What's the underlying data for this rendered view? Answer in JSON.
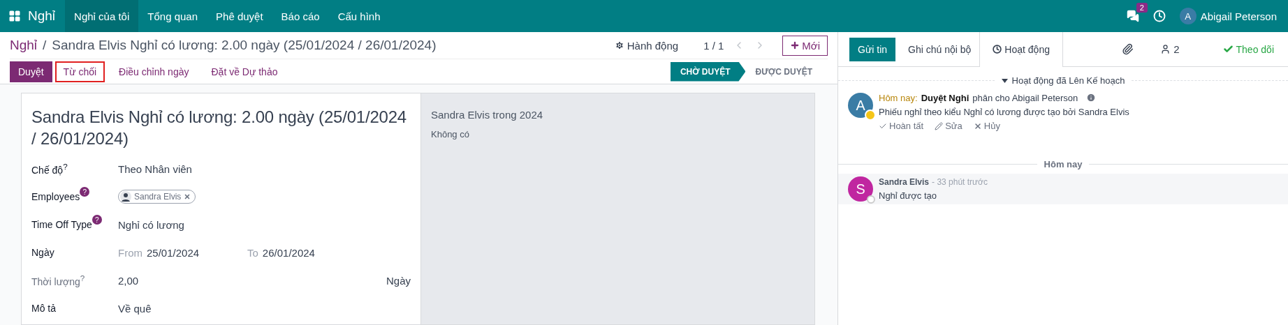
{
  "app": {
    "name": "Nghỉ",
    "menu": [
      {
        "label": "Nghỉ của tôi",
        "selected": true
      },
      {
        "label": "Tổng quan",
        "selected": false
      },
      {
        "label": "Phê duyệt",
        "selected": false
      },
      {
        "label": "Báo cáo",
        "selected": false
      },
      {
        "label": "Cấu hình",
        "selected": false
      }
    ]
  },
  "systray": {
    "messages_badge": "2",
    "user": {
      "initial": "A",
      "name": "Abigail Peterson"
    }
  },
  "breadcrumb": {
    "parent": "Nghỉ",
    "separator": "/",
    "current": "Sandra Elvis Nghỉ có lương: 2.00 ngày (25/01/2024 / 26/01/2024)"
  },
  "actions_label": "Hành động",
  "pager": "1 / 1",
  "new_button": "Mới",
  "buttons": [
    {
      "label": "Duyệt",
      "kind": "primary",
      "highlighted": false
    },
    {
      "label": "Từ chối",
      "kind": "link",
      "highlighted": true
    },
    {
      "label": "Điều chỉnh ngày",
      "kind": "link",
      "highlighted": false
    },
    {
      "label": "Đặt về Dự thảo",
      "kind": "link",
      "highlighted": false
    }
  ],
  "statusbar": [
    {
      "label": "CHỜ DUYỆT",
      "selected": true
    },
    {
      "label": "ĐƯỢC DUYỆT",
      "selected": false
    }
  ],
  "form": {
    "title": "Sandra Elvis Nghỉ có lương: 2.00 ngày (25/01/2024 / 26/01/2024)",
    "fields": [
      {
        "kind": "text",
        "label": "Chế độ$^{?}$",
        "muted": false,
        "value": "Theo Nhân viên"
      },
      {
        "kind": "tags",
        "label": "Employees",
        "help": "?",
        "muted": false,
        "tags": [
          "Sandra Elvis"
        ]
      },
      {
        "kind": "text",
        "label": "Time Off Type",
        "help": "?",
        "muted": false,
        "value": "Nghỉ có lương"
      },
      {
        "kind": "daterange",
        "label": "Ngày",
        "muted": false,
        "from_label": "From",
        "from": "25/01/2024",
        "to_label": "To",
        "to": "26/01/2024"
      },
      {
        "kind": "duration",
        "label": "Thời lượng$^{?}$",
        "muted": true,
        "value": "2,00",
        "unit": "Ngày"
      },
      {
        "kind": "text",
        "label": "Mô tả",
        "muted": false,
        "value": "Về quê"
      }
    ]
  },
  "side_panel": {
    "title": "Sandra Elvis trong 2024",
    "text": "Không có"
  },
  "chatter": {
    "tabs": [
      {
        "kind": "send",
        "label": "Gửi tin",
        "selected": true
      },
      {
        "kind": "note",
        "label": "Ghi chú nội bộ",
        "selected": false
      },
      {
        "kind": "activity",
        "label": "Hoạt động",
        "selected": false
      }
    ],
    "followers": "2",
    "follow": "Theo dõi",
    "activity_header": "Hoạt động đã Lên Kế hoạch",
    "activities": [
      {
        "initial": "A",
        "when": "Hôm nay:",
        "summary": "Duyệt Nghỉ",
        "assignee": "phân cho Abigail Peterson",
        "note": "Phiếu nghỉ theo kiểu Nghỉ có lương được tạo bởi Sandra Elvis",
        "actions": [
          {
            "kind": "done",
            "label": "Hoàn tất"
          },
          {
            "kind": "edit",
            "label": "Sửa"
          },
          {
            "kind": "cancel",
            "label": "Hủy"
          }
        ]
      }
    ],
    "date_divider": "Hôm nay",
    "messages": [
      {
        "initial": "S",
        "author": "Sandra Elvis",
        "time": "- 33 phút trước",
        "body": "Nghỉ được tạo"
      }
    ]
  }
}
